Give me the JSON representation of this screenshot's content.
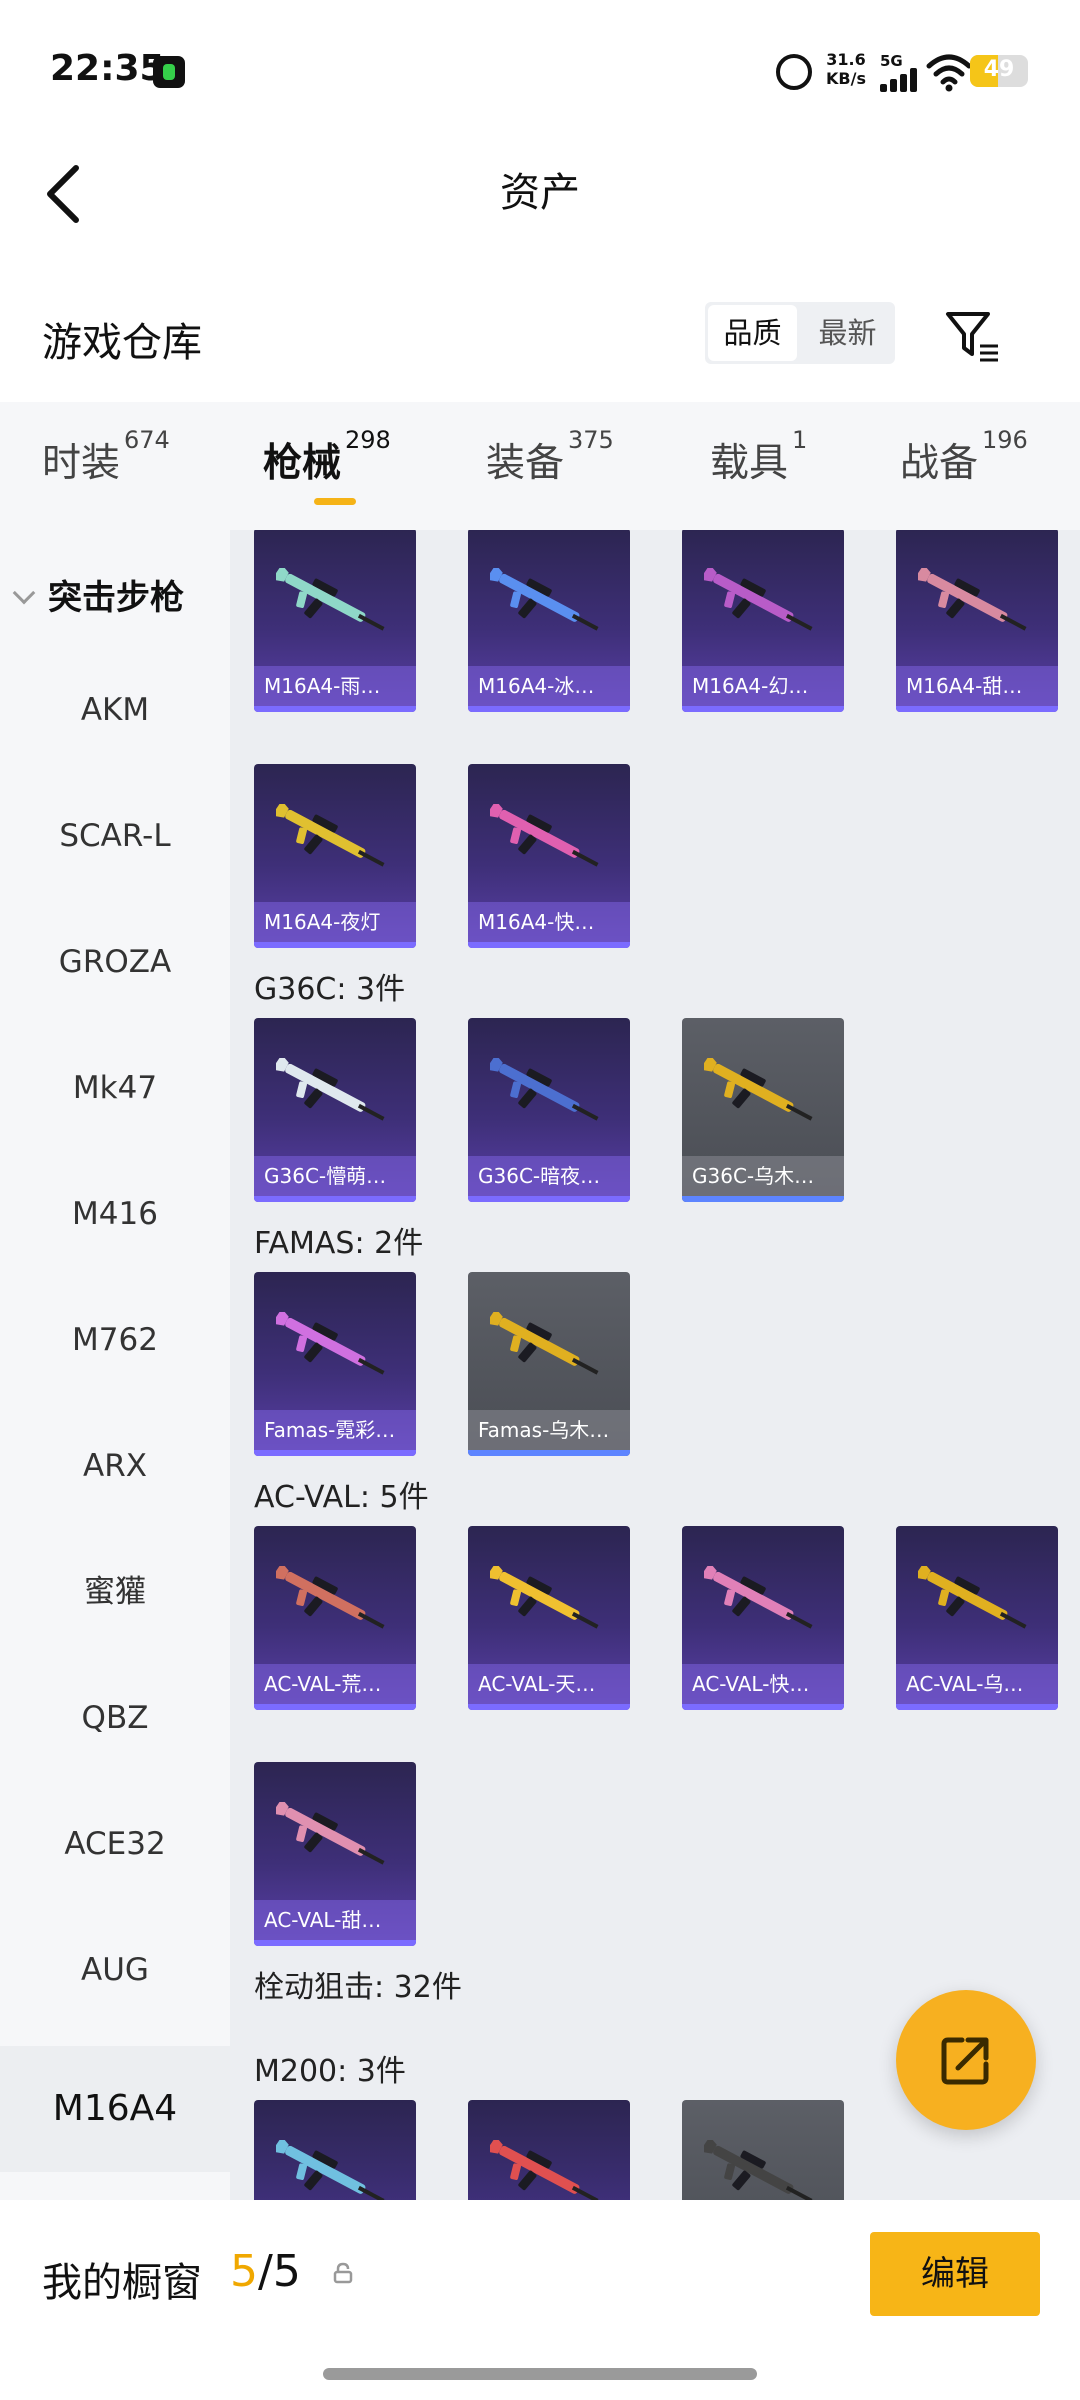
{
  "status_bar": {
    "time": "22:35",
    "speed_value": "31.6",
    "speed_unit": "KB/s",
    "network": "5G",
    "battery": "49",
    "battery_level": 0.49
  },
  "header": {
    "title": "资产"
  },
  "warehouse": {
    "title": "游戏仓库",
    "sort_options": [
      "品质",
      "最新"
    ],
    "sort_selected": "品质"
  },
  "tabs": [
    {
      "label": "时装",
      "count": "674"
    },
    {
      "label": "枪械",
      "count": "298"
    },
    {
      "label": "装备",
      "count": "375"
    },
    {
      "label": "载具",
      "count": "1"
    },
    {
      "label": "战备",
      "count": "196"
    }
  ],
  "sidebar": {
    "group": "突击步枪",
    "items": [
      "AKM",
      "SCAR-L",
      "GROZA",
      "Mk47",
      "M416",
      "M762",
      "ARX",
      "蜜獾",
      "QBZ",
      "ACE32",
      "AUG",
      "M16A4"
    ],
    "selected": "M16A4"
  },
  "sections": [
    {
      "label": "",
      "items": [
        {
          "name": "M16A4-雨…",
          "rarity": "purple",
          "color": "#8fd8c8"
        },
        {
          "name": "M16A4-冰…",
          "rarity": "purple",
          "color": "#5a8ff0"
        },
        {
          "name": "M16A4-幻…",
          "rarity": "purple",
          "color": "#b85cc8"
        },
        {
          "name": "M16A4-甜…",
          "rarity": "purple",
          "color": "#d88aa0"
        },
        {
          "name": "M16A4-夜灯",
          "rarity": "purple",
          "color": "#e0c030"
        },
        {
          "name": "M16A4-快…",
          "rarity": "purple",
          "color": "#e060b0"
        }
      ]
    },
    {
      "label": "G36C: 3件",
      "items": [
        {
          "name": "G36C-懵萌…",
          "rarity": "purple",
          "color": "#dfe8ee"
        },
        {
          "name": "G36C-暗夜…",
          "rarity": "purple",
          "color": "#4c6fd0"
        },
        {
          "name": "G36C-乌木…",
          "rarity": "grey",
          "color": "#e0b020"
        }
      ]
    },
    {
      "label": "FAMAS: 2件",
      "items": [
        {
          "name": "Famas-霓彩…",
          "rarity": "purple",
          "color": "#d070e0"
        },
        {
          "name": "Famas-乌木…",
          "rarity": "grey",
          "color": "#e0b020"
        }
      ]
    },
    {
      "label": "AC-VAL: 5件",
      "items": [
        {
          "name": "AC-VAL-荒…",
          "rarity": "purple",
          "color": "#d07060"
        },
        {
          "name": "AC-VAL-天…",
          "rarity": "purple",
          "color": "#f0c030"
        },
        {
          "name": "AC-VAL-快…",
          "rarity": "purple",
          "color": "#e080b8"
        },
        {
          "name": "AC-VAL-乌…",
          "rarity": "purple",
          "color": "#e0b020"
        },
        {
          "name": "AC-VAL-甜…",
          "rarity": "purple",
          "color": "#e090b0"
        }
      ]
    },
    {
      "label": "栓动狙击: 32件",
      "items": []
    },
    {
      "label": "M200: 3件",
      "items": [
        {
          "name": "",
          "rarity": "purple",
          "color": "#70c0e0"
        },
        {
          "name": "",
          "rarity": "purple",
          "color": "#e05050"
        },
        {
          "name": "",
          "rarity": "grey",
          "color": "#444444"
        }
      ]
    }
  ],
  "showcase": {
    "label": "我的橱窗",
    "current": "5",
    "separator": "/",
    "total": "5",
    "edit_label": "编辑"
  },
  "colors": {
    "accent": "#f7b517",
    "card_purple": "#3e2f78",
    "card_grey": "#505359"
  }
}
